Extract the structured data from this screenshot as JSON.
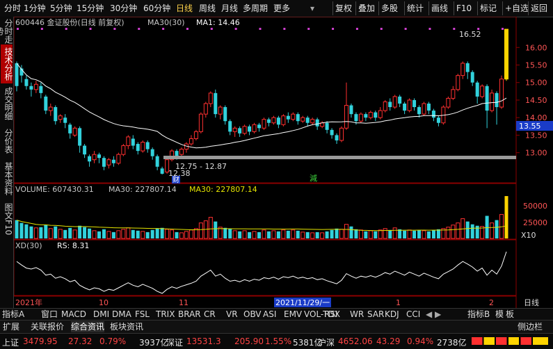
{
  "toolbar": {
    "left_items": [
      "分时",
      "1分钟",
      "5分钟",
      "15分钟",
      "30分钟",
      "60分钟",
      "日线",
      "周线",
      "月线",
      "多周期",
      "更多"
    ],
    "active": "日线",
    "right_items": [
      "复权",
      "叠加",
      "多股",
      "统计",
      "画线",
      "F10",
      "标记",
      "+自选",
      "返回"
    ]
  },
  "left_tabs": [
    "分时走势",
    "技术分析",
    "成交明细",
    "分价表",
    "基本资料",
    "图文F10"
  ],
  "left_tab_active": "技术分析",
  "price_panel": {
    "title": "600446 金证股份(日线 前复权)",
    "ma_label": "MA30(30)",
    "ma1_label": "MA1: 14.46",
    "high_label": "16.52",
    "low_range_label": "12.75 - 12.87",
    "low_label": "12.38",
    "cai_marker": "财",
    "jian_marker": "減",
    "current_price": "13.55",
    "y_ticks": [
      "16.00",
      "15.50",
      "15.00",
      "14.50",
      "14.00",
      "13.50",
      "13.00"
    ]
  },
  "volume_panel": {
    "volume_label": "VOLUME: 607430.31",
    "ma30_label_1": "MA30: 227807.14",
    "ma30_label_2": "MA30: 227807.14",
    "y_ticks": [
      "50000",
      "25000"
    ],
    "unit": "X10"
  },
  "xd_panel": {
    "label": "XD(30)",
    "rs_label": "RS: 8.31"
  },
  "x_axis": {
    "year": "2021年",
    "month_10": "10",
    "month_11": "11",
    "cursor_date": "2021/11/29/一",
    "month_1": "1",
    "month_2": "2",
    "period": "日线"
  },
  "indicator_bar": {
    "prefix": "指标A",
    "items": [
      "窗口",
      "MACD",
      "DMI",
      "DMA",
      "FSL",
      "TRIX",
      "BRAR",
      "CR",
      "VR",
      "OBV",
      "ASI",
      "EMV",
      "VOL-TDX",
      "RSI",
      "WR",
      "SAR",
      "KDJ",
      "CCI"
    ],
    "suffix": "指标B",
    "model": "模",
    "board": "板"
  },
  "tab_bar": {
    "items": [
      "扩展",
      "关联报价",
      "综合资讯",
      "板块资讯"
    ],
    "active": "综合资讯",
    "sidebar": "侧边栏"
  },
  "status_bar": {
    "sh_name": "上证",
    "sh_value": "3479.95",
    "sh_change": "27.32",
    "sh_pct": "0.79%",
    "sh_amount": "3937亿",
    "sz_name": "深证",
    "sz_value": "13531.3",
    "sz_change": "205.90",
    "sz_pct": "1.55%",
    "sz_amount": "5381亿",
    "hs_name": "沪深",
    "hs_value": "4652.06",
    "hs_change": "43.29",
    "hs_pct": "0.94%",
    "hs_amount": "2738亿"
  },
  "chart_data": {
    "type": "candlestick",
    "price_ylim": [
      12.2,
      16.6
    ],
    "candles": [
      [
        14.9,
        15.55,
        14.75,
        15.6,
        0,
        26000
      ],
      [
        15.4,
        15.2,
        15.0,
        15.5,
        0,
        22000
      ],
      [
        15.1,
        14.9,
        14.8,
        15.2,
        0,
        20000
      ],
      [
        14.9,
        14.8,
        14.6,
        15.0,
        0,
        17000
      ],
      [
        14.8,
        14.95,
        14.7,
        15.05,
        1,
        15000
      ],
      [
        14.9,
        14.7,
        14.55,
        15.0,
        0,
        16000
      ],
      [
        14.6,
        14.2,
        14.1,
        14.65,
        0,
        19000
      ],
      [
        14.2,
        14.3,
        14.05,
        14.4,
        1,
        14000
      ],
      [
        14.3,
        13.9,
        13.8,
        14.35,
        0,
        17000
      ],
      [
        13.95,
        14.05,
        13.85,
        14.1,
        1,
        13000
      ],
      [
        14.0,
        13.85,
        13.7,
        14.1,
        0,
        12000
      ],
      [
        13.8,
        13.55,
        13.4,
        13.85,
        0,
        15000
      ],
      [
        13.5,
        13.7,
        13.45,
        13.75,
        1,
        12000
      ],
      [
        13.7,
        13.2,
        13.0,
        13.75,
        0,
        18000
      ],
      [
        13.2,
        12.95,
        12.85,
        13.25,
        0,
        16000
      ],
      [
        12.9,
        12.75,
        12.6,
        12.95,
        0,
        14000
      ],
      [
        12.8,
        12.95,
        12.7,
        13.05,
        1,
        11000
      ],
      [
        12.95,
        12.85,
        12.7,
        13.0,
        0,
        10000
      ],
      [
        12.85,
        12.6,
        12.5,
        12.9,
        0,
        13000
      ],
      [
        12.65,
        12.8,
        12.55,
        12.85,
        1,
        10000
      ],
      [
        12.8,
        12.7,
        12.6,
        12.9,
        0,
        9000
      ],
      [
        12.7,
        12.95,
        12.65,
        13.0,
        1,
        11000
      ],
      [
        12.95,
        13.2,
        12.9,
        13.25,
        1,
        13000
      ],
      [
        13.2,
        13.45,
        13.1,
        13.5,
        1,
        15000
      ],
      [
        13.4,
        13.2,
        13.1,
        13.5,
        0,
        12000
      ],
      [
        13.25,
        13.05,
        12.95,
        13.3,
        0,
        11000
      ],
      [
        13.05,
        13.3,
        13.0,
        13.35,
        1,
        10000
      ],
      [
        13.3,
        13.1,
        13.0,
        13.35,
        0,
        9000
      ],
      [
        13.1,
        12.9,
        12.8,
        13.15,
        0,
        12000
      ],
      [
        12.9,
        12.6,
        12.5,
        12.95,
        0,
        14000
      ],
      [
        12.55,
        12.4,
        12.38,
        12.6,
        0,
        15000
      ],
      [
        12.45,
        12.8,
        12.4,
        12.85,
        1,
        13000
      ],
      [
        12.8,
        13.05,
        12.75,
        13.1,
        1,
        12000
      ],
      [
        13.05,
        12.9,
        12.8,
        13.1,
        0,
        9000
      ],
      [
        12.95,
        13.1,
        12.9,
        13.15,
        1,
        8000
      ],
      [
        13.1,
        13.25,
        13.0,
        13.3,
        1,
        10000
      ],
      [
        13.25,
        13.4,
        13.2,
        13.5,
        1,
        12000
      ],
      [
        13.4,
        13.6,
        13.35,
        13.65,
        1,
        14000
      ],
      [
        13.6,
        14.1,
        13.55,
        14.15,
        1,
        22000
      ],
      [
        14.1,
        14.4,
        14.0,
        14.45,
        1,
        25000
      ],
      [
        14.4,
        14.7,
        14.3,
        14.75,
        1,
        30000
      ],
      [
        14.7,
        14.1,
        14.0,
        14.8,
        0,
        24000
      ],
      [
        14.1,
        14.3,
        13.95,
        14.35,
        1,
        16000
      ],
      [
        14.3,
        13.9,
        13.8,
        14.35,
        0,
        15000
      ],
      [
        13.9,
        13.6,
        13.5,
        13.95,
        0,
        14000
      ],
      [
        13.6,
        13.7,
        13.45,
        13.75,
        1,
        11000
      ],
      [
        13.7,
        13.55,
        13.45,
        13.75,
        0,
        10000
      ],
      [
        13.55,
        13.75,
        13.5,
        13.8,
        1,
        11000
      ],
      [
        13.75,
        13.6,
        13.5,
        13.8,
        0,
        9000
      ],
      [
        13.6,
        13.8,
        13.55,
        13.85,
        1,
        10000
      ],
      [
        13.8,
        13.7,
        13.6,
        13.85,
        0,
        9000
      ],
      [
        13.7,
        13.95,
        13.65,
        14.0,
        1,
        12000
      ],
      [
        13.95,
        13.85,
        13.75,
        14.0,
        0,
        10000
      ],
      [
        13.85,
        14.0,
        13.8,
        14.05,
        1,
        11000
      ],
      [
        14.0,
        13.8,
        13.7,
        14.05,
        0,
        10000
      ],
      [
        13.8,
        14.05,
        13.75,
        14.1,
        1,
        12000
      ],
      [
        14.05,
        13.95,
        13.85,
        14.15,
        0,
        11000
      ],
      [
        13.95,
        14.1,
        13.9,
        14.15,
        1,
        12000
      ],
      [
        14.1,
        13.9,
        13.8,
        14.15,
        0,
        11000
      ],
      [
        13.9,
        14.0,
        13.85,
        14.05,
        1,
        9000
      ],
      [
        14.0,
        13.85,
        13.75,
        14.05,
        0,
        9000
      ],
      [
        13.85,
        13.95,
        13.8,
        14.0,
        1,
        8000
      ],
      [
        13.95,
        13.75,
        13.65,
        14.0,
        0,
        9000
      ],
      [
        13.75,
        13.85,
        13.7,
        13.9,
        1,
        8000
      ],
      [
        13.85,
        13.65,
        13.55,
        13.9,
        0,
        10000
      ],
      [
        13.65,
        13.5,
        13.4,
        13.7,
        0,
        12000
      ],
      [
        13.5,
        13.35,
        13.25,
        13.55,
        0,
        14000
      ],
      [
        13.35,
        13.7,
        13.3,
        13.75,
        1,
        13000
      ],
      [
        13.7,
        14.35,
        13.65,
        15.0,
        1,
        20000
      ],
      [
        14.35,
        14.1,
        14.0,
        14.4,
        0,
        17000
      ],
      [
        14.1,
        13.9,
        13.8,
        14.15,
        0,
        13000
      ],
      [
        13.9,
        14.1,
        13.85,
        14.15,
        1,
        12000
      ],
      [
        14.1,
        14.0,
        13.9,
        14.15,
        0,
        10000
      ],
      [
        14.0,
        14.15,
        13.95,
        14.2,
        1,
        11000
      ],
      [
        14.15,
        14.0,
        13.9,
        14.2,
        0,
        10000
      ],
      [
        14.0,
        14.2,
        13.95,
        14.3,
        1,
        12000
      ],
      [
        14.2,
        14.45,
        14.15,
        14.5,
        1,
        14000
      ],
      [
        14.45,
        14.3,
        14.2,
        14.55,
        0,
        12000
      ],
      [
        14.3,
        14.6,
        14.25,
        14.65,
        1,
        15000
      ],
      [
        14.6,
        14.4,
        14.3,
        14.65,
        0,
        13000
      ],
      [
        14.4,
        14.2,
        14.1,
        14.45,
        0,
        11000
      ],
      [
        14.2,
        14.5,
        14.15,
        14.55,
        1,
        12000
      ],
      [
        14.5,
        14.3,
        14.2,
        14.55,
        0,
        11000
      ],
      [
        14.3,
        14.1,
        14.0,
        14.35,
        0,
        12000
      ],
      [
        14.1,
        14.4,
        14.05,
        14.45,
        1,
        11000
      ],
      [
        14.4,
        14.2,
        14.1,
        14.45,
        0,
        10000
      ],
      [
        14.2,
        14.0,
        13.9,
        14.25,
        0,
        12000
      ],
      [
        14.0,
        13.85,
        13.75,
        14.05,
        0,
        13000
      ],
      [
        13.85,
        14.3,
        13.8,
        14.35,
        1,
        14000
      ],
      [
        14.3,
        14.55,
        14.25,
        14.6,
        1,
        16000
      ],
      [
        14.55,
        14.8,
        14.5,
        14.9,
        1,
        19000
      ],
      [
        14.8,
        15.2,
        14.75,
        15.25,
        1,
        22000
      ],
      [
        15.2,
        15.55,
        15.1,
        15.6,
        1,
        28000
      ],
      [
        15.55,
        15.3,
        15.1,
        15.6,
        0,
        24000
      ],
      [
        15.3,
        15.0,
        14.9,
        15.35,
        0,
        20000
      ],
      [
        15.0,
        14.6,
        14.4,
        15.05,
        0,
        18000
      ],
      [
        14.6,
        14.9,
        14.55,
        14.95,
        1,
        17000
      ],
      [
        14.9,
        14.2,
        13.7,
        14.95,
        0,
        32000
      ],
      [
        14.2,
        14.7,
        14.15,
        14.8,
        1,
        22000
      ],
      [
        14.7,
        14.3,
        13.8,
        14.75,
        0,
        26000
      ],
      [
        14.3,
        15.1,
        14.25,
        15.2,
        1,
        34000
      ],
      [
        15.1,
        16.52,
        15.05,
        16.52,
        2,
        60000
      ]
    ]
  }
}
